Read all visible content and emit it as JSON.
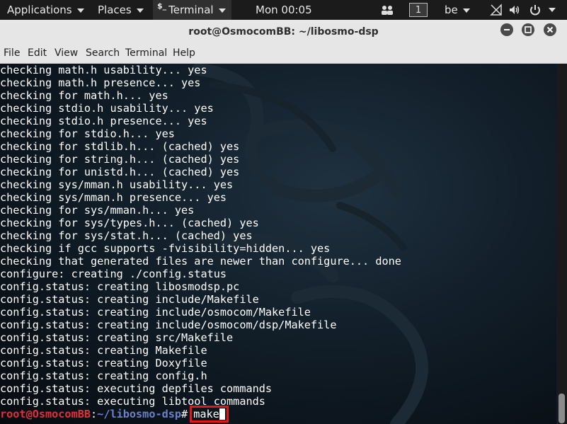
{
  "topbar": {
    "applications": "Applications",
    "places": "Places",
    "terminal_app": "Terminal",
    "terminal_glyph": "$_",
    "clock": "Mon 00:05",
    "workspace": "1",
    "keyboard_layout": "be"
  },
  "window": {
    "title": "root@OsmocomBB: ~/libosmo-dsp"
  },
  "menu": {
    "file": "File",
    "edit": "Edit",
    "view": "View",
    "search": "Search",
    "terminal": "Terminal",
    "help": "Help"
  },
  "terminal": {
    "lines": [
      "checking math.h usability... yes",
      "checking math.h presence... yes",
      "checking for math.h... yes",
      "checking stdio.h usability... yes",
      "checking stdio.h presence... yes",
      "checking for stdio.h... yes",
      "checking for stdlib.h... (cached) yes",
      "checking for string.h... (cached) yes",
      "checking for unistd.h... (cached) yes",
      "checking sys/mman.h usability... yes",
      "checking sys/mman.h presence... yes",
      "checking for sys/mman.h... yes",
      "checking for sys/types.h... (cached) yes",
      "checking for sys/stat.h... (cached) yes",
      "checking if gcc supports -fvisibility=hidden... yes",
      "checking that generated files are newer than configure... done",
      "configure: creating ./config.status",
      "config.status: creating libosmodsp.pc",
      "config.status: creating include/Makefile",
      "config.status: creating include/osmocom/Makefile",
      "config.status: creating include/osmocom/dsp/Makefile",
      "config.status: creating src/Makefile",
      "config.status: creating Makefile",
      "config.status: creating Doxyfile",
      "config.status: creating config.h",
      "config.status: executing depfiles commands",
      "config.status: executing libtool commands"
    ],
    "prompt_user": "root@OsmocomBB",
    "prompt_sep": ":",
    "prompt_path": "~/libosmo-dsp",
    "prompt_symbol": "#",
    "command": "make"
  },
  "icons": {
    "apps_caret": "chevron-down-icon",
    "people": "people-icon",
    "network_off": "network-disabled-icon",
    "volume": "volume-icon",
    "power": "power-icon",
    "minimize": "minimize-icon",
    "maximize": "maximize-icon",
    "close": "close-icon"
  },
  "colors": {
    "prompt_user": "#e0313a",
    "prompt_path": "#6b82c8",
    "highlight": "#e01818"
  }
}
